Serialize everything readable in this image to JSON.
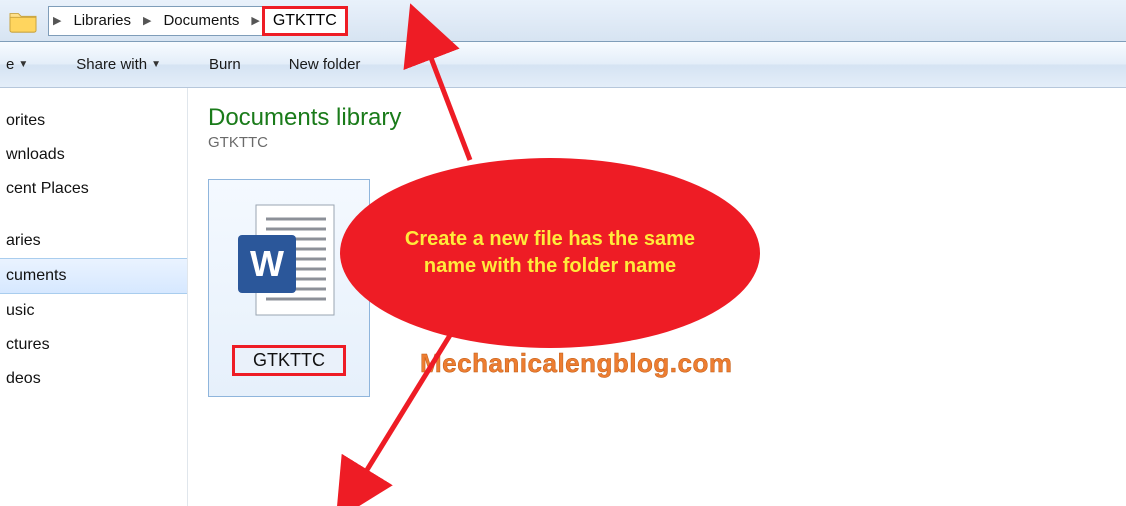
{
  "breadcrumb": {
    "root_icon": "folder",
    "items": [
      "Libraries",
      "Documents"
    ],
    "current": "GTKTTC"
  },
  "toolbar": {
    "organize": "e",
    "share": "Share with",
    "burn": "Burn",
    "newfolder": "New folder"
  },
  "sidebar": {
    "group1": [
      "orites",
      "wnloads",
      "cent Places"
    ],
    "group2": [
      "aries",
      "cuments",
      "usic",
      "ctures",
      "deos"
    ],
    "selected_index": 1
  },
  "library": {
    "title": "Documents library",
    "subtitle": "GTKTTC"
  },
  "file": {
    "name": "GTKTTC",
    "type": "word-document"
  },
  "annotation": {
    "text": "Create a new file has the same name with the folder name",
    "watermark": "Mechanicalengblog.com"
  }
}
